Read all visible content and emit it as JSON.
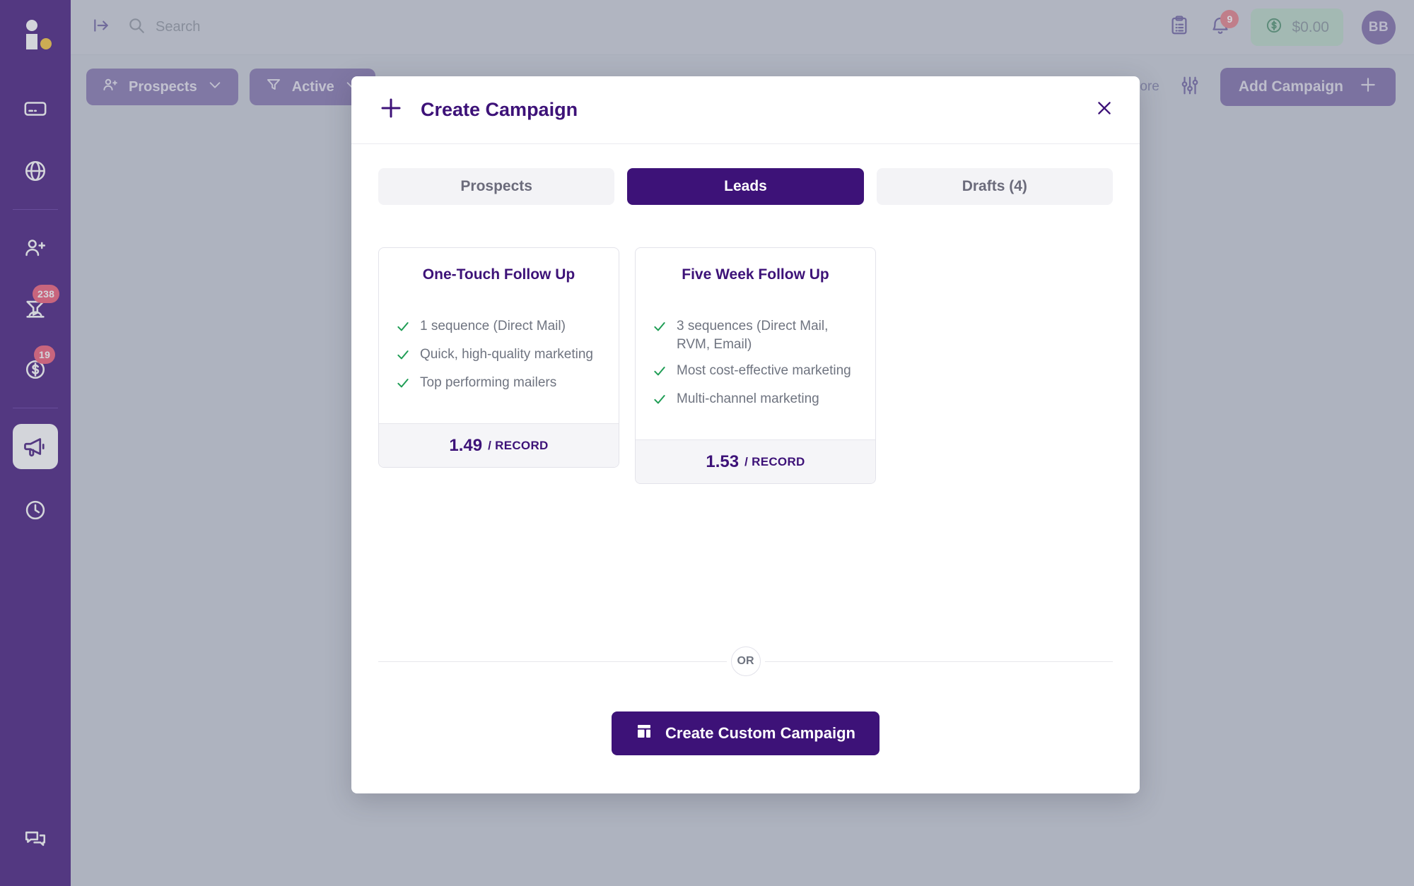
{
  "app": {
    "logo_name": "brand-logo",
    "accent_purple": "#3d1278",
    "accent_yellow": "#f5c132",
    "badge_red": "#ef5573",
    "check_green": "#1f9d55"
  },
  "sidebar": {
    "items": [
      {
        "name": "credit-card",
        "icon": "credit-card-icon",
        "badge": ""
      },
      {
        "name": "globe",
        "icon": "globe-icon",
        "badge": ""
      },
      {
        "name": "add-contact",
        "icon": "person-add-icon",
        "badge": ""
      },
      {
        "name": "leads-funnel",
        "icon": "funnel-group-icon",
        "badge": "238"
      },
      {
        "name": "deals",
        "icon": "dollar-circle-icon",
        "badge": "19"
      },
      {
        "name": "campaigns",
        "icon": "megaphone-icon",
        "badge": "",
        "active": true
      },
      {
        "name": "history",
        "icon": "clock-icon",
        "badge": ""
      }
    ],
    "bottom_item": {
      "name": "support-chat",
      "icon": "chat-bubbles-icon"
    }
  },
  "header": {
    "collapse_icon": "collapse-panel-icon",
    "search": {
      "icon": "search-icon",
      "placeholder": "Search",
      "value": ""
    },
    "clipboard_icon": "clipboard-list-icon",
    "notifications": {
      "icon": "bell-icon",
      "count": "9"
    },
    "wallet": {
      "icon": "dollar-circle-icon",
      "amount": "$0.00"
    },
    "avatar_initials": "BB"
  },
  "toolbar": {
    "prospects_chip": {
      "label": "Prospects",
      "icon": "person-add-icon",
      "caret": "chevron-down-icon"
    },
    "active_chip": {
      "label": "Active",
      "icon": "filter-funnel-icon",
      "caret": "chevron-down-icon"
    },
    "learn_more": {
      "label": "Learn More",
      "icon": "external-link-icon"
    },
    "settings_icon": "sliders-icon",
    "add_campaign": {
      "label": "Add Campaign",
      "icon": "plus-icon"
    }
  },
  "modal": {
    "title": "Create Campaign",
    "title_icon": "plus-icon",
    "close_icon": "close-icon",
    "tabs": [
      {
        "label": "Prospects",
        "active": false
      },
      {
        "label": "Leads",
        "active": true
      },
      {
        "label": "Drafts (4)",
        "active": false
      }
    ],
    "cards": [
      {
        "title": "One-Touch Follow Up",
        "features": [
          "1 sequence (Direct Mail)",
          "Quick, high-quality marketing",
          "Top performing mailers"
        ],
        "price": "1.49",
        "price_unit": "/ RECORD"
      },
      {
        "title": "Five Week Follow Up",
        "features": [
          "3 sequences (Direct Mail, RVM, Email)",
          "Most cost-effective marketing",
          "Multi-channel marketing"
        ],
        "price": "1.53",
        "price_unit": "/ RECORD"
      }
    ],
    "divider_label": "OR",
    "custom_button": {
      "label": "Create Custom Campaign",
      "icon": "layout-dashboard-icon"
    }
  }
}
